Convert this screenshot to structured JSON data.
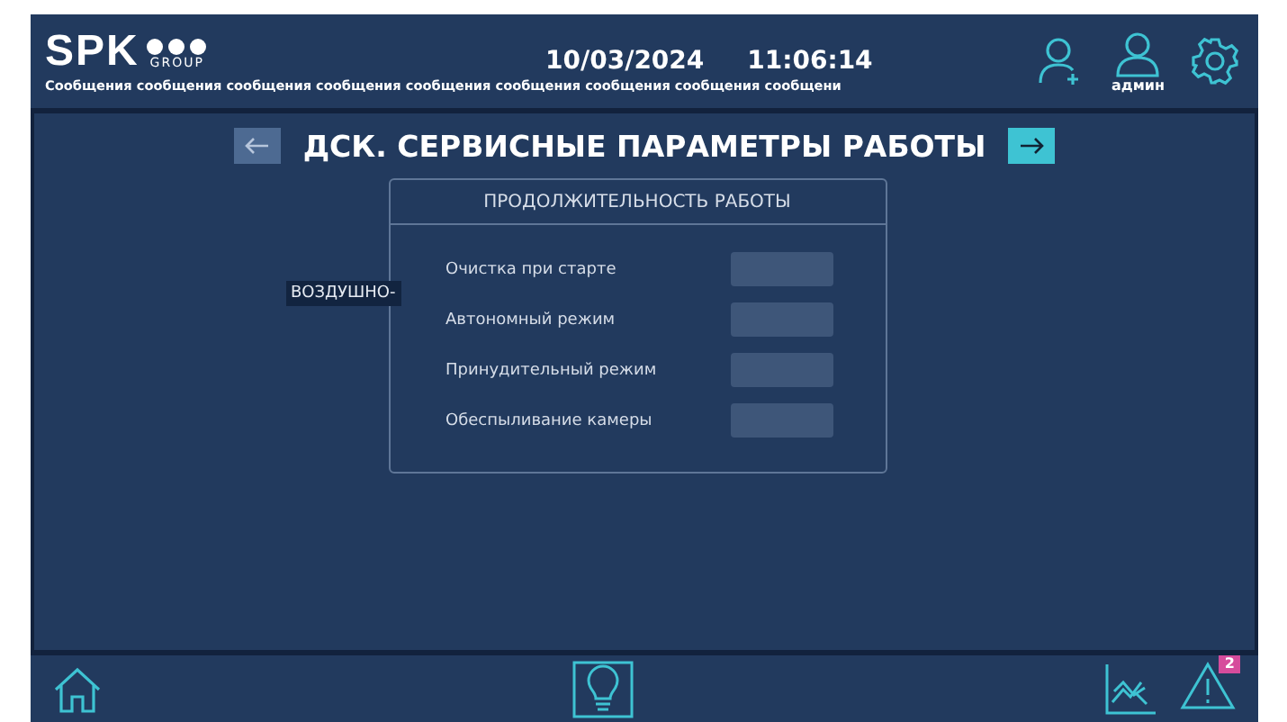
{
  "header": {
    "logo": "SPK",
    "logo_sub": "GROUP",
    "date": "10/03/2024",
    "time": "11:06:14",
    "messages": "Сообщения сообщения сообщения сообщения сообщения сообщения сообщения сообщения сообщени",
    "user": "админ"
  },
  "nav": {
    "title": "ДСК. СЕРВИСНЫЕ ПАРАМЕТРЫ РАБОТЫ",
    "prev_enabled": false,
    "next_enabled": true
  },
  "side_label": "ВОЗДУШНО-",
  "card": {
    "title": "ПРОДОЛЖИТЕЛЬНОСТЬ РАБОТЫ",
    "rows": [
      {
        "label": "Очистка при старте"
      },
      {
        "label": "Автономный режим"
      },
      {
        "label": "Принудительный режим"
      },
      {
        "label": "Обеспыливание камеры"
      }
    ]
  },
  "footer": {
    "alarm_count": "2"
  }
}
